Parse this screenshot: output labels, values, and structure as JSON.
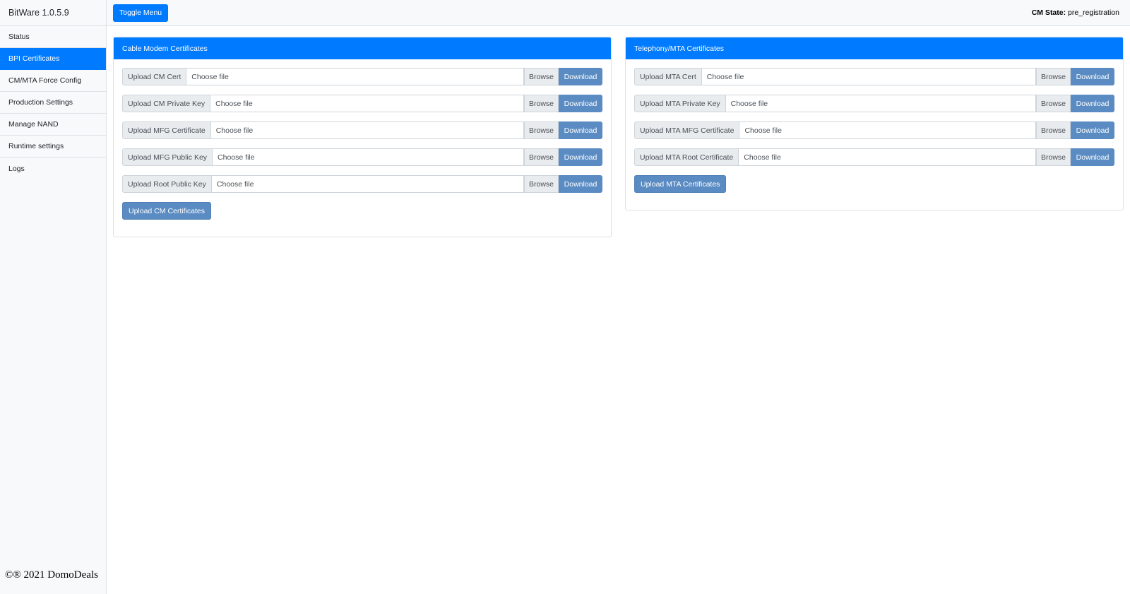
{
  "sidebar": {
    "brand": "BitWare 1.0.5.9",
    "items": [
      {
        "label": "Status"
      },
      {
        "label": "BPI Certificates"
      },
      {
        "label": "CM/MTA Force Config"
      },
      {
        "label": "Production Settings"
      },
      {
        "label": "Manage NAND"
      },
      {
        "label": "Runtime settings"
      },
      {
        "label": "Logs"
      }
    ],
    "active_item": "BPI Certificates",
    "copyright": "©® 2021 DomoDeals"
  },
  "topbar": {
    "toggle_label": "Toggle Menu",
    "cm_state_label": "CM State:",
    "cm_state_value": "pre_registration"
  },
  "colors": {
    "primary": "#007bff",
    "secondary_button": "#5a8bc2",
    "sidebar_bg": "#f8f9fa"
  },
  "cm_card": {
    "title": "Cable Modem Certificates",
    "rows": [
      {
        "label": "Upload CM Cert",
        "file": "Choose file",
        "browse": "Browse",
        "download": "Download"
      },
      {
        "label": "Upload CM Private Key",
        "file": "Choose file",
        "browse": "Browse",
        "download": "Download"
      },
      {
        "label": "Upload MFG Certificate",
        "file": "Choose file",
        "browse": "Browse",
        "download": "Download"
      },
      {
        "label": "Upload MFG Public Key",
        "file": "Choose file",
        "browse": "Browse",
        "download": "Download"
      },
      {
        "label": "Upload Root Public Key",
        "file": "Choose file",
        "browse": "Browse",
        "download": "Download"
      }
    ],
    "submit": "Upload CM Certificates"
  },
  "mta_card": {
    "title": "Telephony/MTA Certificates",
    "rows": [
      {
        "label": "Upload MTA Cert",
        "file": "Choose file",
        "browse": "Browse",
        "download": "Download"
      },
      {
        "label": "Upload MTA Private Key",
        "file": "Choose file",
        "browse": "Browse",
        "download": "Download"
      },
      {
        "label": "Upload MTA MFG Certificate",
        "file": "Choose file",
        "browse": "Browse",
        "download": "Download"
      },
      {
        "label": "Upload MTA Root Certificate",
        "file": "Choose file",
        "browse": "Browse",
        "download": "Download"
      }
    ],
    "submit": "Upload MTA Certificates"
  }
}
